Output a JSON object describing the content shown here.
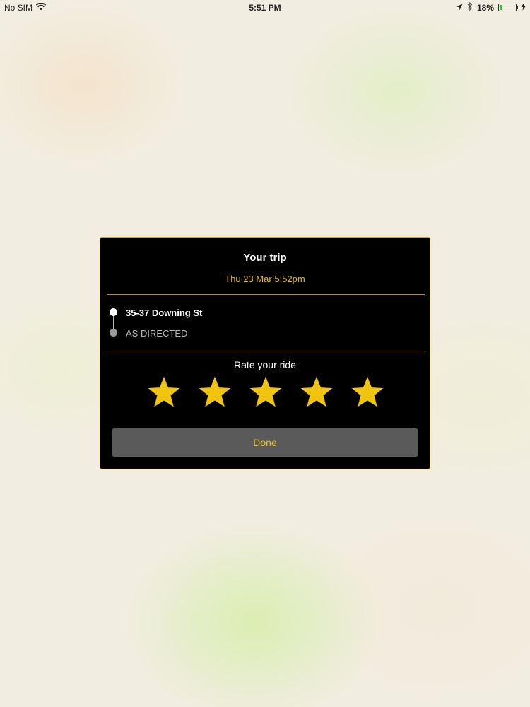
{
  "status_bar": {
    "carrier": "No SIM",
    "time": "5:51 PM",
    "battery_percent_label": "18%",
    "battery_level": 0.18,
    "icons": [
      "wifi-icon",
      "location-arrow-icon",
      "bluetooth-icon",
      "battery-icon",
      "charging-bolt-icon"
    ]
  },
  "trip": {
    "title": "Your trip",
    "date": "Thu 23 Mar 5:52pm",
    "pickup": "35-37 Downing St",
    "dropoff": "AS DIRECTED"
  },
  "rating": {
    "label": "Rate your ride",
    "stars_filled": 5,
    "stars_total": 5,
    "star_color": "#f1c40f"
  },
  "done_button": {
    "label": "Done"
  },
  "colors": {
    "card_background": "#000000",
    "accent": "#e6bc1c",
    "button_background": "#5a5a5a"
  }
}
